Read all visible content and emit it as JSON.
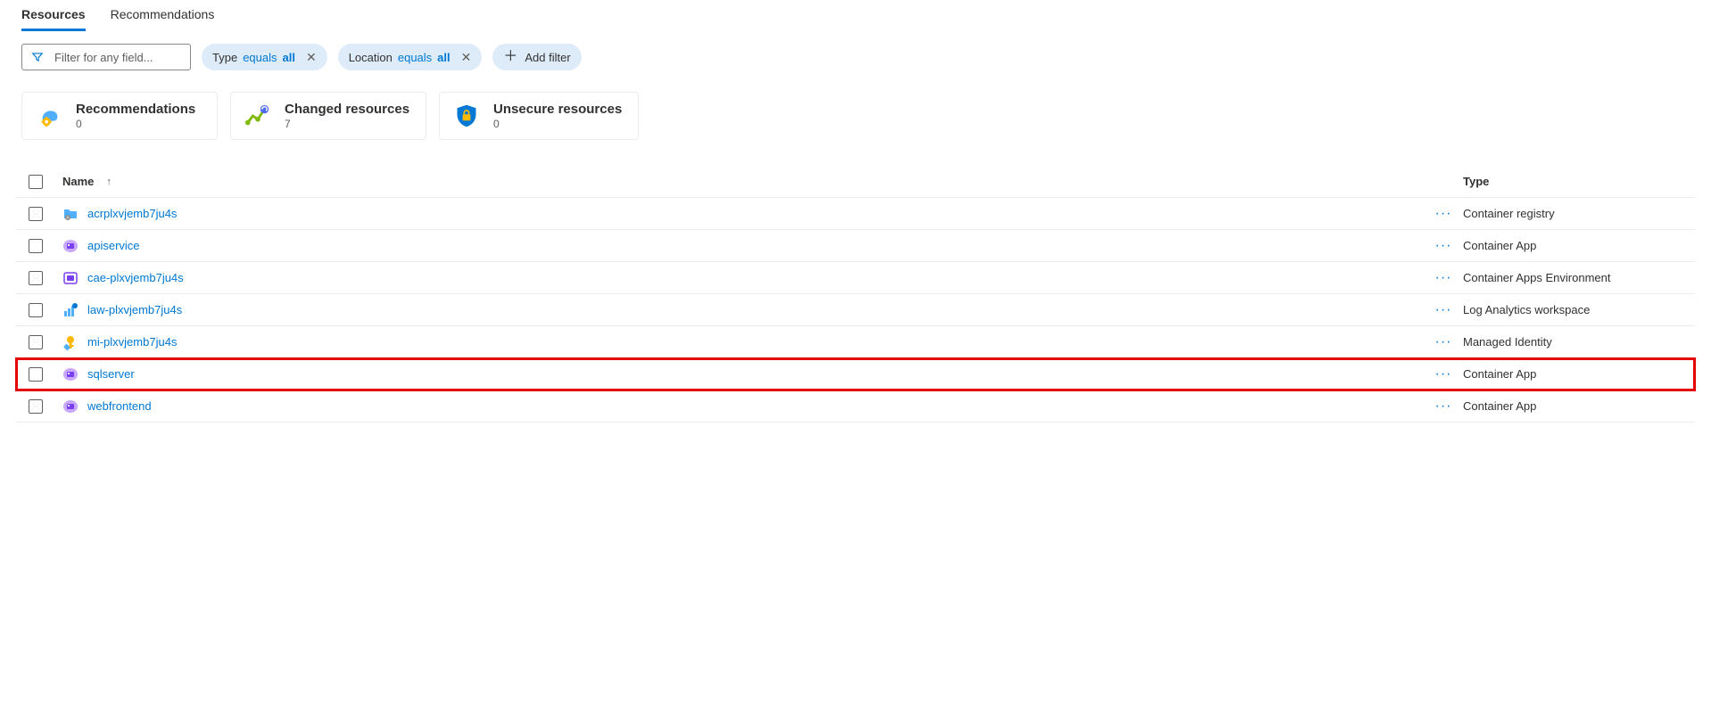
{
  "tabs": [
    {
      "label": "Resources",
      "active": true
    },
    {
      "label": "Recommendations",
      "active": false
    }
  ],
  "filter": {
    "placeholder": "Filter for any field..."
  },
  "pills": {
    "type": {
      "prefix": "Type ",
      "mid": "equals ",
      "value": "all"
    },
    "location": {
      "prefix": "Location ",
      "mid": "equals ",
      "value": "all"
    },
    "add": {
      "label": "Add filter"
    }
  },
  "cards": [
    {
      "title": "Recommendations",
      "count": "0",
      "icon": "recommendations"
    },
    {
      "title": "Changed resources",
      "count": "7",
      "icon": "changed"
    },
    {
      "title": "Unsecure resources",
      "count": "0",
      "icon": "unsecure"
    }
  ],
  "columns": {
    "name": "Name",
    "type": "Type"
  },
  "rows": [
    {
      "icon": "registry",
      "name": "acrplxvjemb7ju4s",
      "type": "Container registry",
      "highlight": false
    },
    {
      "icon": "containerapp",
      "name": "apiservice",
      "type": "Container App",
      "highlight": false
    },
    {
      "icon": "cae",
      "name": "cae-plxvjemb7ju4s",
      "type": "Container Apps Environment",
      "highlight": false
    },
    {
      "icon": "law",
      "name": "law-plxvjemb7ju4s",
      "type": "Log Analytics workspace",
      "highlight": false
    },
    {
      "icon": "identity",
      "name": "mi-plxvjemb7ju4s",
      "type": "Managed Identity",
      "highlight": false
    },
    {
      "icon": "containerapp",
      "name": "sqlserver",
      "type": "Container App",
      "highlight": true
    },
    {
      "icon": "containerapp",
      "name": "webfrontend",
      "type": "Container App",
      "highlight": false
    }
  ]
}
